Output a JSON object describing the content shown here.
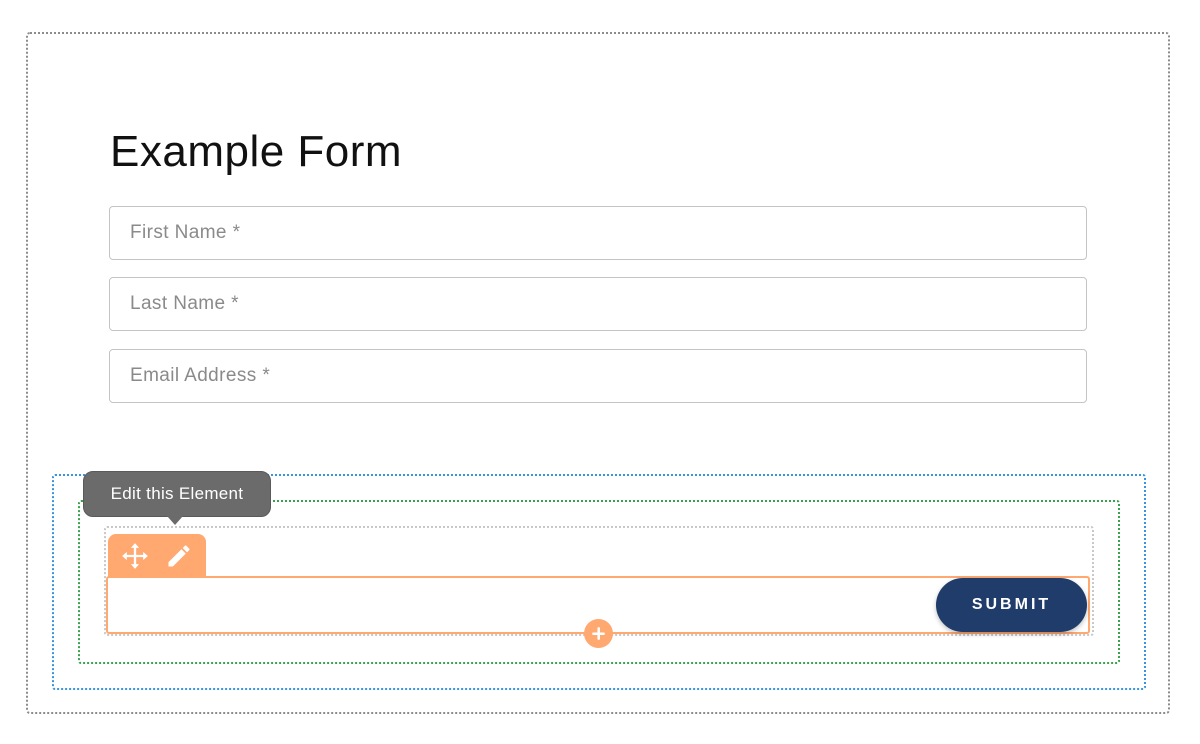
{
  "form": {
    "title": "Example Form",
    "fields": [
      {
        "placeholder": "First Name *",
        "value": ""
      },
      {
        "placeholder": "Last Name *",
        "value": ""
      },
      {
        "placeholder": "Email Address *",
        "value": ""
      }
    ],
    "submit_label": "SUBMIT"
  },
  "editor": {
    "tooltip": "Edit this Element",
    "toolbar_icons": [
      "move-icon",
      "pencil-icon"
    ],
    "add_icon": "plus-icon",
    "colors": {
      "accent": "#ffa870",
      "submit": "#1f3c6b",
      "tooltip_bg": "#6b6b6b",
      "section_outline": "#3b92df",
      "row_outline": "#3aa14f",
      "column_outline": "#c8c8c8"
    }
  }
}
